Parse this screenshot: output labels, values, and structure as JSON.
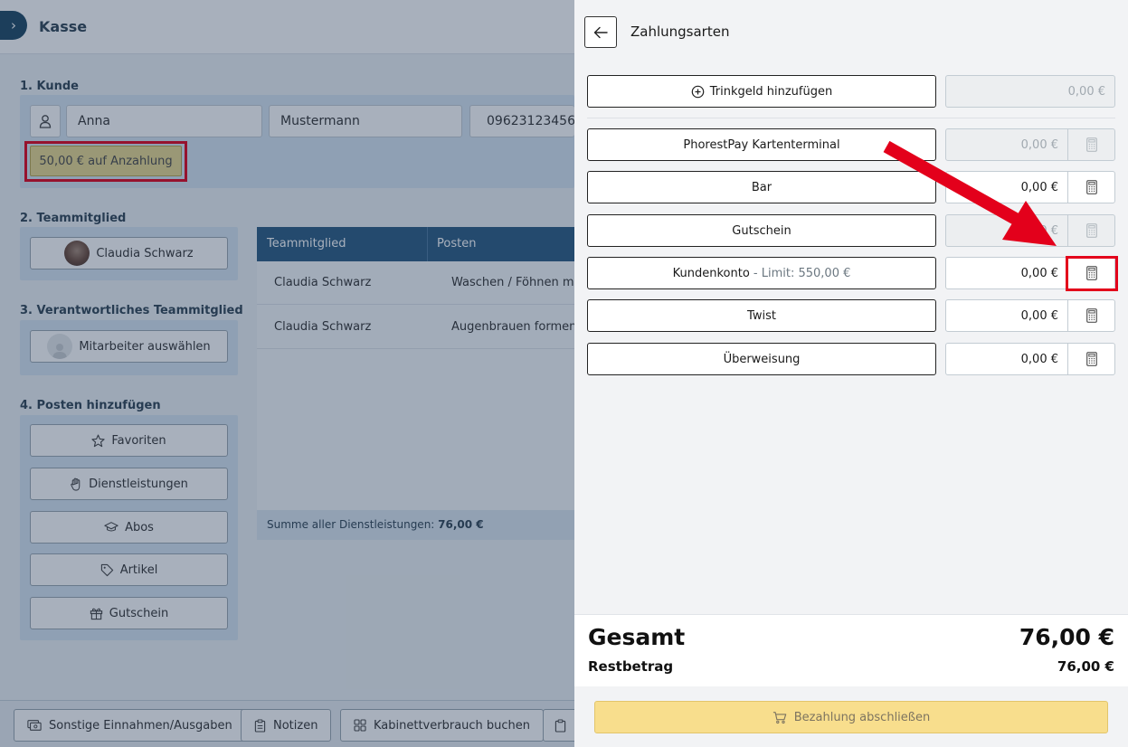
{
  "app": {
    "title": "Kasse",
    "toggle_glyph": "›"
  },
  "customer": {
    "section_label": "1. Kunde",
    "first_name": "Anna",
    "last_name": "Mustermann",
    "phone": "09623123456",
    "deposit_button": "50,00 € auf Anzahlung"
  },
  "team_member": {
    "section_label": "2. Teammitglied",
    "selected": "Claudia Schwarz"
  },
  "responsible": {
    "section_label": "3. Verantwortliches Teammitglied",
    "placeholder": "Mitarbeiter auswählen"
  },
  "add_items": {
    "section_label": "4. Posten hinzufügen",
    "buttons": [
      {
        "label": "Favoriten",
        "icon": "star-icon"
      },
      {
        "label": "Dienstleistungen",
        "icon": "hand-icon"
      },
      {
        "label": "Abos",
        "icon": "graduation-cap-icon"
      },
      {
        "label": "Artikel",
        "icon": "tag-icon"
      },
      {
        "label": "Gutschein",
        "icon": "gift-icon"
      }
    ]
  },
  "table": {
    "columns": [
      "Teammitglied",
      "Posten"
    ],
    "rows": [
      [
        "Claudia Schwarz",
        "Waschen / Föhnen mittel"
      ],
      [
        "Claudia Schwarz",
        "Augenbrauen formen"
      ]
    ],
    "sum_label": "Summe aller Dienstleistungen:",
    "sum_value": "76,00 €"
  },
  "bottom_bar": {
    "buttons": [
      "Sonstige Einnahmen/Ausgaben",
      "Notizen",
      "Kabinettverbrauch buchen"
    ]
  },
  "drawer": {
    "title": "Zahlungsarten",
    "tip": {
      "label": "Trinkgeld hinzufügen",
      "amount": "0,00 €"
    },
    "methods": [
      {
        "label": "PhorestPay Kartenterminal",
        "suffix": "",
        "amount": "0,00 €",
        "disabled": true
      },
      {
        "label": "Bar",
        "suffix": "",
        "amount": "0,00 €",
        "disabled": false
      },
      {
        "label": "Gutschein",
        "suffix": "",
        "amount": "0,00 €",
        "disabled": true
      },
      {
        "label": "Kundenkonto",
        "suffix": " - Limit: 550,00 €",
        "amount": "0,00 €",
        "disabled": false
      },
      {
        "label": "Twist",
        "suffix": "",
        "amount": "0,00 €",
        "disabled": false
      },
      {
        "label": "Überweisung",
        "suffix": "",
        "amount": "0,00 €",
        "disabled": false
      }
    ],
    "total_label": "Gesamt",
    "total_value": "76,00 €",
    "rest_label": "Restbetrag",
    "rest_value": "76,00 €",
    "pay_button": "Bezahlung abschließen"
  },
  "colors": {
    "highlight": "#e3001b",
    "primary": "#1e4763",
    "pay_button": "#f8de8d"
  }
}
